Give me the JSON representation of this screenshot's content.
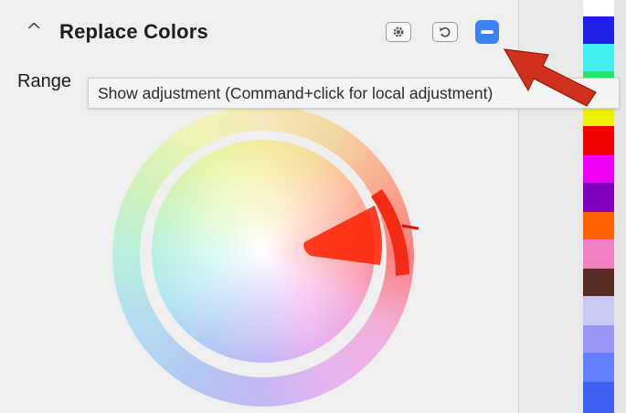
{
  "header": {
    "title": "Replace Colors",
    "collapse_icon": "chevron-up-icon",
    "settings_icon": "gear-icon",
    "reset_icon": "undo-icon",
    "toggle_icon": "minus-icon"
  },
  "range": {
    "label": "Range"
  },
  "tooltip": {
    "text": "Show adjustment (Command+click for local adjustment)"
  },
  "colors": {
    "accent": "#3b82f6",
    "arrow": "#d0311c",
    "swatches": [
      "#ffffff",
      "#2020e8",
      "#40f0f0",
      "#30e060",
      "#f0f000",
      "#f00000",
      "#f000f0",
      "#8000c0",
      "#ff6000",
      "#f080c0",
      "#5a2a24",
      "#c8c8f4",
      "#9898f4",
      "#6080ff",
      "#4060f0"
    ]
  }
}
